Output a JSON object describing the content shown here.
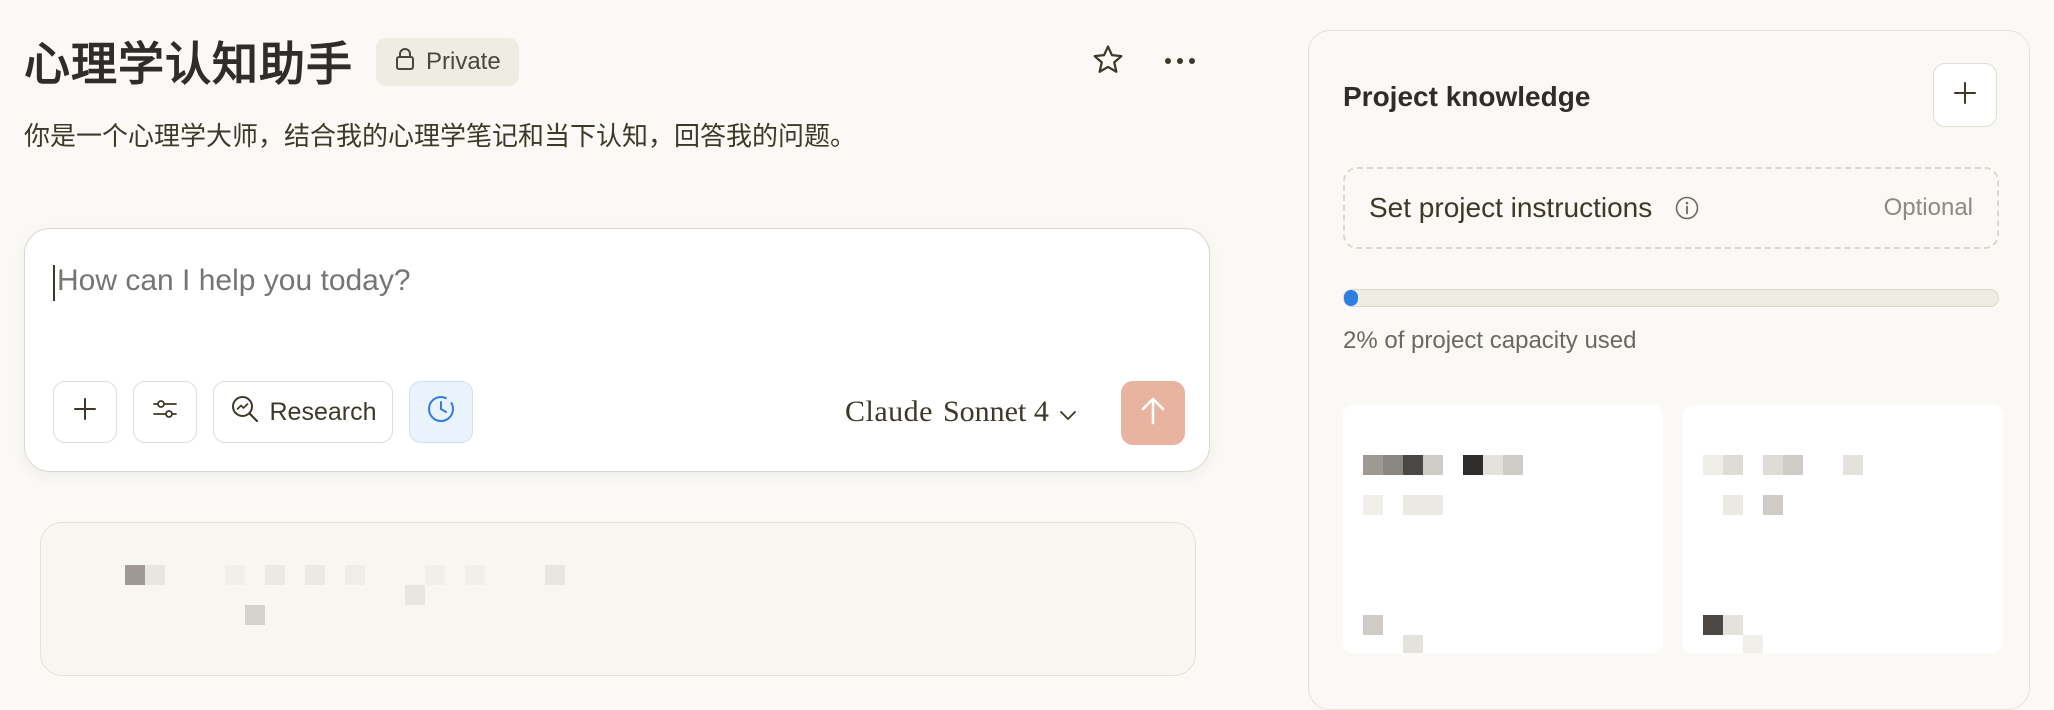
{
  "project": {
    "title": "心理学认知助手",
    "privacy": "Private",
    "description": "你是一个心理学大师，结合我的心理学笔记和当下认知，回答我的问题。"
  },
  "composer": {
    "placeholder": "How can I help you today?",
    "research_label": "Research",
    "model_brand": "Claude",
    "model_name": "Sonnet 4"
  },
  "knowledge": {
    "title": "Project knowledge",
    "instructions_label": "Set project instructions",
    "instructions_optional": "Optional",
    "capacity_fraction": 0.02,
    "capacity_text": "2% of project capacity used"
  },
  "colors": {
    "background": "#faf9f5",
    "send_button": "#e8b4a0",
    "capacity_bar": "#2f7ee0"
  }
}
